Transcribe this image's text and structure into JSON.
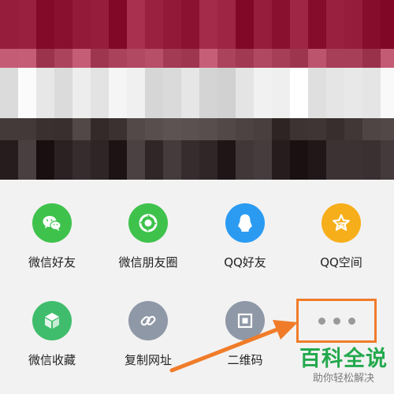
{
  "share_sheet": {
    "items": [
      {
        "label": "微信好友",
        "icon": "wechat-chat-icon",
        "color": "#3fc24c"
      },
      {
        "label": "微信朋友圈",
        "icon": "wechat-moments-icon",
        "color": "#3fc24c"
      },
      {
        "label": "QQ好友",
        "icon": "qq-icon",
        "color": "#2b9bf2"
      },
      {
        "label": "QQ空间",
        "icon": "qzone-star-icon",
        "color": "#f7ae1b"
      },
      {
        "label": "微信收藏",
        "icon": "favorites-cube-icon",
        "color": "#3fbd6c"
      },
      {
        "label": "复制网址",
        "icon": "link-icon",
        "color": "#8e98a6"
      },
      {
        "label": "二维码",
        "icon": "qr-code-icon",
        "color": "#8e98a6"
      }
    ],
    "more": {
      "icon": "more-dots-icon",
      "highlight_color": "#f07c2a"
    }
  },
  "watermark": {
    "title": "百科全说",
    "subtitle": "助你轻松解决",
    "title_color": "#23a94d"
  }
}
